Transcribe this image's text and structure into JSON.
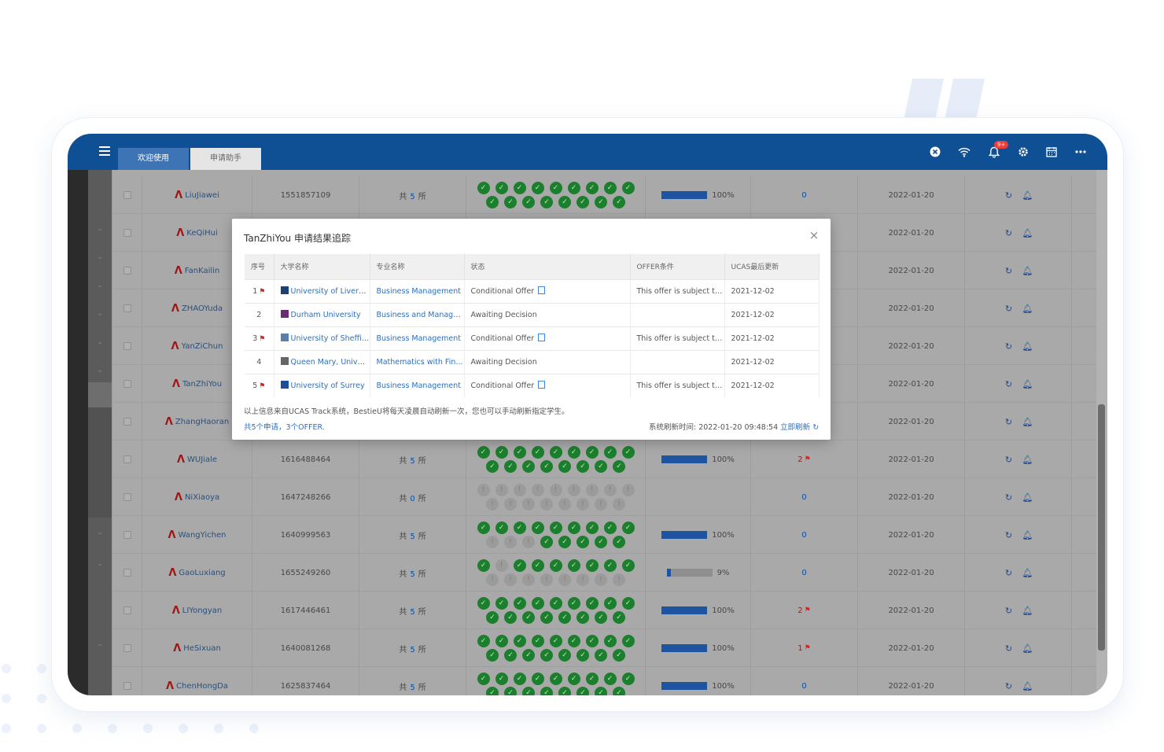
{
  "app": {
    "tabs": [
      {
        "label": "欢迎使用"
      },
      {
        "label": "申请助手"
      }
    ],
    "notification_badge": "9+"
  },
  "students": [
    {
      "name": "LiuJiawei",
      "id": "1551857109",
      "apps": "5",
      "progress": "100%",
      "flags": "0"
    },
    {
      "name": "KeQiHui",
      "id": "",
      "apps": "",
      "progress": "",
      "flags": ""
    },
    {
      "name": "FanKailin",
      "id": "",
      "apps": "",
      "progress": "",
      "flags": ""
    },
    {
      "name": "ZHAOYuda",
      "id": "",
      "apps": "",
      "progress": "",
      "flags": ""
    },
    {
      "name": "YanZiChun",
      "id": "",
      "apps": "",
      "progress": "",
      "flags": ""
    },
    {
      "name": "TanZhiYou",
      "id": "",
      "apps": "",
      "progress": "",
      "flags": ""
    },
    {
      "name": "ZhangHaoran",
      "id": "",
      "apps": "",
      "progress": "",
      "flags": ""
    },
    {
      "name": "WUJiale",
      "id": "1616488464",
      "apps": "5",
      "progress": "100%",
      "flags": "2"
    },
    {
      "name": "NiXiaoya",
      "id": "1647248266",
      "apps": "0",
      "progress": "",
      "flags": "0"
    },
    {
      "name": "WangYichen",
      "id": "1640999563",
      "apps": "5",
      "progress": "100%",
      "flags": "0"
    },
    {
      "name": "GaoLuxiang",
      "id": "1655249260",
      "apps": "5",
      "progress": "9%",
      "flags": "0"
    },
    {
      "name": "LIYongyan",
      "id": "1617446461",
      "apps": "5",
      "progress": "100%",
      "flags": "2"
    },
    {
      "name": "HeSixuan",
      "id": "1640081268",
      "apps": "5",
      "progress": "100%",
      "flags": "1"
    },
    {
      "name": "ChenHongDa",
      "id": "1625837464",
      "apps": "5",
      "progress": "100%",
      "flags": "0"
    }
  ],
  "grid": {
    "date": "2022-01-20",
    "count_prefix": "共",
    "count_suffix": "所"
  },
  "modal": {
    "title": "TanZhiYou 申请结果追踪",
    "headers": [
      "序号",
      "大学名称",
      "专业名称",
      "状态",
      "OFFER条件",
      "UCAS最后更新"
    ],
    "rows": [
      {
        "no": "1",
        "uni": "University of Liverpool",
        "course": "Business Management",
        "status": "Conditional Offer",
        "cond": "This offer is subject to...",
        "date": "2021-12-02"
      },
      {
        "no": "2",
        "uni": "Durham University",
        "course": "Business and Manage...",
        "status": "Awaiting Decision",
        "cond": "",
        "date": "2021-12-02"
      },
      {
        "no": "3",
        "uni": "University of Sheffield",
        "course": "Business Management",
        "status": "Conditional Offer",
        "cond": "This offer is subject to...",
        "date": "2021-12-02"
      },
      {
        "no": "4",
        "uni": "Queen Mary, Universit",
        "course": "Mathematics with Fin...",
        "status": "Awaiting Decision",
        "cond": "",
        "date": "2021-12-02"
      },
      {
        "no": "5",
        "uni": "University of Surrey",
        "course": "Business Management",
        "status": "Conditional Offer",
        "cond": "This offer is subject to...",
        "date": "2021-12-02"
      }
    ],
    "note": "以上信息来自UCAS Track系统，BestieU将每天凌晨自动刷新一次，您也可以手动刷新指定学生。",
    "summary": "共5个申请，3个OFFER.",
    "refresh_time": "系统刷新时间: 2022-01-20 09:48:54",
    "refresh_now": "立即刷新"
  },
  "colors": {
    "brand": "#0f4f94",
    "green": "#1c7f2d",
    "link": "#2c6fbe",
    "flag": "#d22424"
  }
}
